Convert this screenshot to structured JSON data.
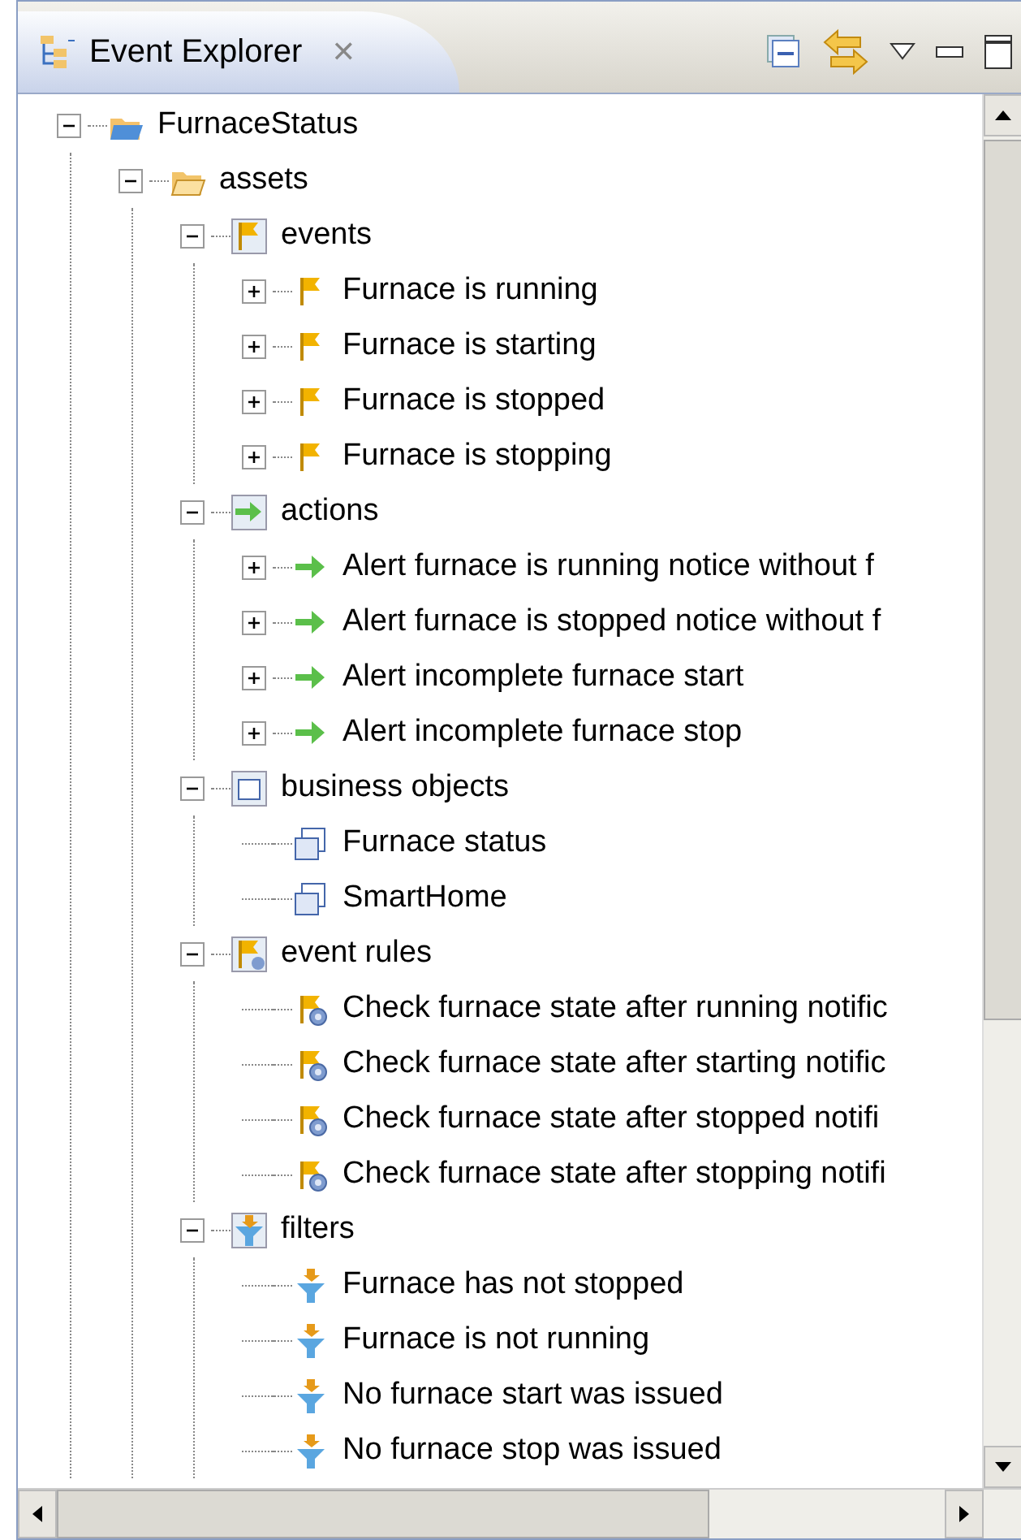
{
  "view_tab": {
    "title": "Event Explorer",
    "close": "✕",
    "selected": true
  },
  "tree": [
    {
      "label": "FurnaceStatus",
      "kind": "project",
      "expanded": true,
      "children": [
        {
          "label": "assets",
          "kind": "folder",
          "expanded": true,
          "children": [
            {
              "label": "events",
              "kind": "events",
              "expanded": true,
              "children": [
                {
                  "label": "Furnace is running",
                  "kind": "event",
                  "expanded": false
                },
                {
                  "label": "Furnace is starting",
                  "kind": "event",
                  "expanded": false
                },
                {
                  "label": "Furnace is stopped",
                  "kind": "event",
                  "expanded": false
                },
                {
                  "label": "Furnace is stopping",
                  "kind": "event",
                  "expanded": false
                }
              ]
            },
            {
              "label": "actions",
              "kind": "actions",
              "expanded": true,
              "children": [
                {
                  "label": "Alert furnace is running notice without f",
                  "kind": "action",
                  "expanded": false
                },
                {
                  "label": "Alert furnace is stopped notice without f",
                  "kind": "action",
                  "expanded": false
                },
                {
                  "label": "Alert incomplete furnace start",
                  "kind": "action",
                  "expanded": false
                },
                {
                  "label": "Alert incomplete furnace stop",
                  "kind": "action",
                  "expanded": false
                }
              ]
            },
            {
              "label": "business objects",
              "kind": "objects",
              "expanded": true,
              "children": [
                {
                  "label": "Furnace status",
                  "kind": "object"
                },
                {
                  "label": "SmartHome",
                  "kind": "object"
                }
              ]
            },
            {
              "label": "event rules",
              "kind": "rules",
              "expanded": true,
              "children": [
                {
                  "label": "Check furnace state after running notific",
                  "kind": "rule"
                },
                {
                  "label": "Check furnace state after starting notific",
                  "kind": "rule"
                },
                {
                  "label": "Check furnace state after stopped notifi",
                  "kind": "rule"
                },
                {
                  "label": "Check furnace state after stopping notifi",
                  "kind": "rule"
                }
              ]
            },
            {
              "label": "filters",
              "kind": "filters",
              "expanded": true,
              "children": [
                {
                  "label": "Furnace has not stopped",
                  "kind": "filter"
                },
                {
                  "label": "Furnace is not running",
                  "kind": "filter"
                },
                {
                  "label": "No furnace start was issued",
                  "kind": "filter"
                },
                {
                  "label": "No furnace stop was issued",
                  "kind": "filter"
                }
              ]
            }
          ]
        }
      ]
    }
  ]
}
